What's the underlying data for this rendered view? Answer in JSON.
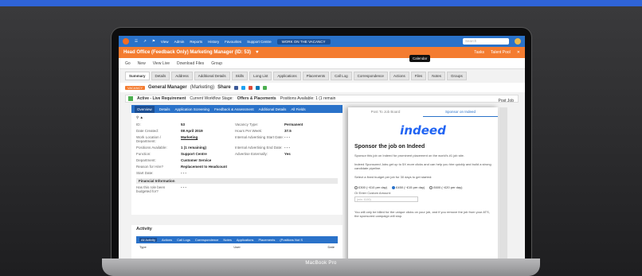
{
  "nav": {
    "items": [
      "View",
      "Admin",
      "Reports",
      "History",
      "Favourites",
      "Support Centre"
    ],
    "work": "WORK ON THE VACANCY",
    "search_placeholder": "Search"
  },
  "header": {
    "title": "Head Office (Feedback Only) Marketing Manager (ID: 53)",
    "tooltip": "Calendar",
    "right": [
      "Tasks",
      "Talent Pool"
    ]
  },
  "toolbar": {
    "items": [
      "Go",
      "New",
      "View Live",
      "Download Files",
      "Group"
    ]
  },
  "tabs": [
    "Summary",
    "Details",
    "Address",
    "Additional Details",
    "Skills",
    "Long List",
    "Applications",
    "Placements",
    "Call Log",
    "Correspondence",
    "Actions",
    "Files",
    "Notes",
    "Groups"
  ],
  "job": {
    "badge": "VACANCY",
    "title": "General Manager",
    "company": "(Marketing)",
    "share": "Share",
    "post": "Post Job"
  },
  "status": {
    "active": "Active - Live Requirement",
    "stage_label": "Current Workflow Stage:",
    "stage": "Offers & Placements",
    "positions": "Positions Available: 1 (1 remain"
  },
  "subtabs": [
    "Overview",
    "Details",
    "Application Screening",
    "Feedback & Assessment",
    "Additional Details",
    "All Fields"
  ],
  "details": {
    "id_label": "ID:",
    "id": "53",
    "created_label": "Date Created:",
    "created": "08 April 2019",
    "location_label": "Work Location / Department:",
    "location": "Marketing",
    "positions_label": "Positions Available:",
    "positions": "1 (1 remaining)",
    "function_label": "Function:",
    "function": "Support Centre",
    "department_label": "Department:",
    "department": "Customer Service",
    "reason_label": "Reason for Hire?",
    "reason": "Replacement to Headcount",
    "start_label": "Start Date:",
    "start": "- - -",
    "vtype_label": "Vacancy Type:",
    "vtype": "Permanent",
    "hours_label": "Hours Per Week:",
    "hours": "37.5",
    "adv_start_label": "Internal Advertising Start Date:",
    "adv_start": "- - -",
    "adv_end_label": "Internal Advertising End Date:",
    "adv_end": "- - -",
    "adv_ext_label": "Advertise Externally:",
    "adv_ext": "Yes",
    "fin_label": "Financial Information",
    "budget_label": "Has this role been budgeted for?",
    "budget": "- - -"
  },
  "activity": {
    "title": "Activity",
    "tabs": [
      "All Activity",
      "Actions",
      "Call Logs",
      "Correspondence",
      "Notes",
      "Applications",
      "Placements",
      "(Positions Not S"
    ],
    "cols": [
      "Type",
      "User",
      "Date"
    ]
  },
  "panel": {
    "tabs": [
      "Post To Job Board",
      "Sponsor on Indeed"
    ],
    "logo": "indeed",
    "title": "Sponsor the job on Indeed",
    "text1": "Sponsor this job on Indeed for prominent placement on the world's #1 job site.",
    "text2": "Indeed Sponsored Jobs get up to 5X more clicks and can help you hire quickly and build a strong candidate pipeline.",
    "text3": "Select a fixed budget per job for 30 days to get started:",
    "options": [
      "£300 (~£10 per day)",
      "£450 (~£15 per day)",
      "£600 (~£20 per day)"
    ],
    "custom_label": "Or Enter Custom Amount:",
    "custom_placeholder": "(min. £150)",
    "footer": "You will only be billed for the unique clicks on your job, and if you remove the job from your ATS, the sponsored campaign will stop."
  },
  "laptop": {
    "label": "MacBook Pro"
  },
  "colors": {
    "band": "#2f64d8",
    "orange": "#f47c30",
    "blue": "#2a72c9",
    "indeed": "#2164f3"
  }
}
